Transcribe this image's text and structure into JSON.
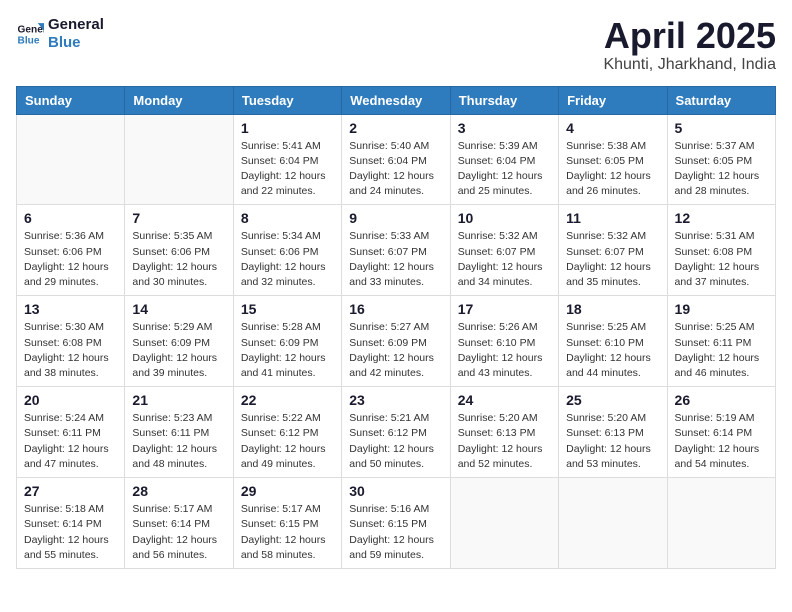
{
  "logo": {
    "line1": "General",
    "line2": "Blue"
  },
  "title": "April 2025",
  "subtitle": "Khunti, Jharkhand, India",
  "weekdays": [
    "Sunday",
    "Monday",
    "Tuesday",
    "Wednesday",
    "Thursday",
    "Friday",
    "Saturday"
  ],
  "weeks": [
    [
      {
        "day": "",
        "info": ""
      },
      {
        "day": "",
        "info": ""
      },
      {
        "day": "1",
        "info": "Sunrise: 5:41 AM\nSunset: 6:04 PM\nDaylight: 12 hours and 22 minutes."
      },
      {
        "day": "2",
        "info": "Sunrise: 5:40 AM\nSunset: 6:04 PM\nDaylight: 12 hours and 24 minutes."
      },
      {
        "day": "3",
        "info": "Sunrise: 5:39 AM\nSunset: 6:04 PM\nDaylight: 12 hours and 25 minutes."
      },
      {
        "day": "4",
        "info": "Sunrise: 5:38 AM\nSunset: 6:05 PM\nDaylight: 12 hours and 26 minutes."
      },
      {
        "day": "5",
        "info": "Sunrise: 5:37 AM\nSunset: 6:05 PM\nDaylight: 12 hours and 28 minutes."
      }
    ],
    [
      {
        "day": "6",
        "info": "Sunrise: 5:36 AM\nSunset: 6:06 PM\nDaylight: 12 hours and 29 minutes."
      },
      {
        "day": "7",
        "info": "Sunrise: 5:35 AM\nSunset: 6:06 PM\nDaylight: 12 hours and 30 minutes."
      },
      {
        "day": "8",
        "info": "Sunrise: 5:34 AM\nSunset: 6:06 PM\nDaylight: 12 hours and 32 minutes."
      },
      {
        "day": "9",
        "info": "Sunrise: 5:33 AM\nSunset: 6:07 PM\nDaylight: 12 hours and 33 minutes."
      },
      {
        "day": "10",
        "info": "Sunrise: 5:32 AM\nSunset: 6:07 PM\nDaylight: 12 hours and 34 minutes."
      },
      {
        "day": "11",
        "info": "Sunrise: 5:32 AM\nSunset: 6:07 PM\nDaylight: 12 hours and 35 minutes."
      },
      {
        "day": "12",
        "info": "Sunrise: 5:31 AM\nSunset: 6:08 PM\nDaylight: 12 hours and 37 minutes."
      }
    ],
    [
      {
        "day": "13",
        "info": "Sunrise: 5:30 AM\nSunset: 6:08 PM\nDaylight: 12 hours and 38 minutes."
      },
      {
        "day": "14",
        "info": "Sunrise: 5:29 AM\nSunset: 6:09 PM\nDaylight: 12 hours and 39 minutes."
      },
      {
        "day": "15",
        "info": "Sunrise: 5:28 AM\nSunset: 6:09 PM\nDaylight: 12 hours and 41 minutes."
      },
      {
        "day": "16",
        "info": "Sunrise: 5:27 AM\nSunset: 6:09 PM\nDaylight: 12 hours and 42 minutes."
      },
      {
        "day": "17",
        "info": "Sunrise: 5:26 AM\nSunset: 6:10 PM\nDaylight: 12 hours and 43 minutes."
      },
      {
        "day": "18",
        "info": "Sunrise: 5:25 AM\nSunset: 6:10 PM\nDaylight: 12 hours and 44 minutes."
      },
      {
        "day": "19",
        "info": "Sunrise: 5:25 AM\nSunset: 6:11 PM\nDaylight: 12 hours and 46 minutes."
      }
    ],
    [
      {
        "day": "20",
        "info": "Sunrise: 5:24 AM\nSunset: 6:11 PM\nDaylight: 12 hours and 47 minutes."
      },
      {
        "day": "21",
        "info": "Sunrise: 5:23 AM\nSunset: 6:11 PM\nDaylight: 12 hours and 48 minutes."
      },
      {
        "day": "22",
        "info": "Sunrise: 5:22 AM\nSunset: 6:12 PM\nDaylight: 12 hours and 49 minutes."
      },
      {
        "day": "23",
        "info": "Sunrise: 5:21 AM\nSunset: 6:12 PM\nDaylight: 12 hours and 50 minutes."
      },
      {
        "day": "24",
        "info": "Sunrise: 5:20 AM\nSunset: 6:13 PM\nDaylight: 12 hours and 52 minutes."
      },
      {
        "day": "25",
        "info": "Sunrise: 5:20 AM\nSunset: 6:13 PM\nDaylight: 12 hours and 53 minutes."
      },
      {
        "day": "26",
        "info": "Sunrise: 5:19 AM\nSunset: 6:14 PM\nDaylight: 12 hours and 54 minutes."
      }
    ],
    [
      {
        "day": "27",
        "info": "Sunrise: 5:18 AM\nSunset: 6:14 PM\nDaylight: 12 hours and 55 minutes."
      },
      {
        "day": "28",
        "info": "Sunrise: 5:17 AM\nSunset: 6:14 PM\nDaylight: 12 hours and 56 minutes."
      },
      {
        "day": "29",
        "info": "Sunrise: 5:17 AM\nSunset: 6:15 PM\nDaylight: 12 hours and 58 minutes."
      },
      {
        "day": "30",
        "info": "Sunrise: 5:16 AM\nSunset: 6:15 PM\nDaylight: 12 hours and 59 minutes."
      },
      {
        "day": "",
        "info": ""
      },
      {
        "day": "",
        "info": ""
      },
      {
        "day": "",
        "info": ""
      }
    ]
  ]
}
